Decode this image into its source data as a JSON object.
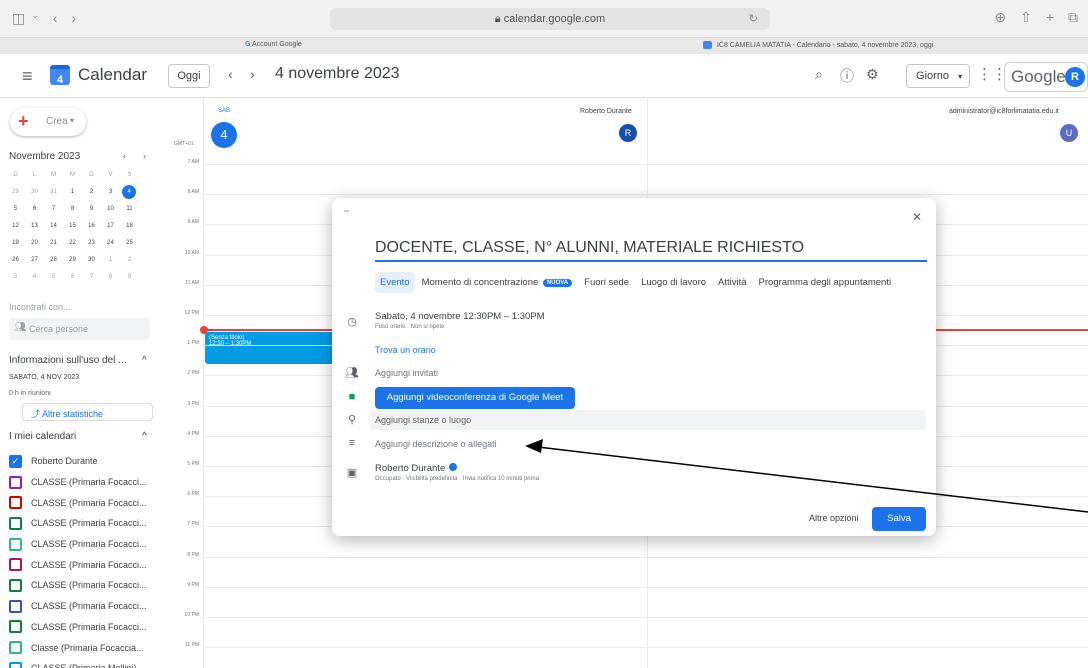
{
  "browser": {
    "url": "calendar.google.com",
    "tabs": [
      "Account Google",
      "IC8 CAMELIA MATATIA - Calendario - sabato, 4 novembre 2023, oggi"
    ]
  },
  "header": {
    "app_name": "Calendar",
    "today_label": "Oggi",
    "date_title": "4 novembre 2023",
    "view_label": "Giorno",
    "google_word": "Google",
    "avatar_letter": "R"
  },
  "sidebar": {
    "create_label": "Crea",
    "mini_calendar": {
      "title": "Novembre 2023",
      "weekdays": [
        "D",
        "L",
        "M",
        "M",
        "G",
        "V",
        "S"
      ],
      "days": [
        {
          "d": "29",
          "muted": true
        },
        {
          "d": "30",
          "muted": true
        },
        {
          "d": "31",
          "muted": true
        },
        {
          "d": "1"
        },
        {
          "d": "2"
        },
        {
          "d": "3"
        },
        {
          "d": "4",
          "selected": true
        },
        {
          "d": "5"
        },
        {
          "d": "6"
        },
        {
          "d": "7"
        },
        {
          "d": "8"
        },
        {
          "d": "9"
        },
        {
          "d": "10"
        },
        {
          "d": "11"
        },
        {
          "d": "12"
        },
        {
          "d": "13"
        },
        {
          "d": "14"
        },
        {
          "d": "15"
        },
        {
          "d": "16"
        },
        {
          "d": "17"
        },
        {
          "d": "18"
        },
        {
          "d": "19"
        },
        {
          "d": "20"
        },
        {
          "d": "21"
        },
        {
          "d": "22"
        },
        {
          "d": "23"
        },
        {
          "d": "24"
        },
        {
          "d": "25"
        },
        {
          "d": "26"
        },
        {
          "d": "27"
        },
        {
          "d": "28"
        },
        {
          "d": "29"
        },
        {
          "d": "30"
        },
        {
          "d": "1",
          "muted": true
        },
        {
          "d": "2",
          "muted": true
        },
        {
          "d": "3",
          "muted": true
        },
        {
          "d": "4",
          "muted": true
        },
        {
          "d": "5",
          "muted": true
        },
        {
          "d": "6",
          "muted": true
        },
        {
          "d": "7",
          "muted": true
        },
        {
          "d": "8",
          "muted": true
        },
        {
          "d": "9",
          "muted": true
        }
      ]
    },
    "meet_title": "Incontrati con...",
    "people_placeholder": "Cerca persone",
    "info_title": "Informazioni sull'uso del ...",
    "info_date": "SABATO, 4 NOV 2023",
    "info_meetings": "0 h in riunioni",
    "stats_label": "Altre statistiche",
    "my_calendars_title": "I miei calendari",
    "calendars": [
      {
        "name": "Roberto Durante",
        "color": "#1a73e8",
        "checked": true
      },
      {
        "name": "CLASSE (Primaria Focacci...",
        "color": "#8e24aa",
        "checked": false
      },
      {
        "name": "CLASSE (Primaria Focacci...",
        "color": "#d50000",
        "checked": false
      },
      {
        "name": "CLASSE (Primaria Focacci...",
        "color": "#0b8043",
        "checked": false
      },
      {
        "name": "CLASSE (Primaria Focacci...",
        "color": "#33b679",
        "checked": false
      },
      {
        "name": "CLASSE (Primaria Focacci...",
        "color": "#ad1457",
        "checked": false
      },
      {
        "name": "CLASSE (Primaria Focacci...",
        "color": "#0b8043",
        "checked": false
      },
      {
        "name": "CLASSE (Primaria Focacci...",
        "color": "#3f51b5",
        "checked": false
      },
      {
        "name": "CLASSE (Primaria Focacci...",
        "color": "#0b8043",
        "checked": false
      },
      {
        "name": "Classe (Primaria Focaccia...",
        "color": "#33b679",
        "checked": false
      },
      {
        "name": "CLASSE (Primaria Mellini) ...",
        "color": "#039be5",
        "checked": false
      }
    ]
  },
  "grid": {
    "timezone": "GMT+01",
    "day_abbr": "SAB",
    "day_number": "4",
    "users": [
      {
        "name": "Roberto Durante",
        "letter": "R",
        "color": "#174ea6"
      },
      {
        "name": "administrator@ic8forlimatatia.edu.it",
        "letter": "U",
        "color": "#5c6bc0"
      }
    ],
    "hours": [
      "7 AM",
      "8 AM",
      "9 AM",
      "10 AM",
      "11 AM",
      "12 PM",
      "1 PM",
      "2 PM",
      "3 PM",
      "4 PM",
      "5 PM",
      "6 PM",
      "7 PM",
      "8 PM",
      "9 PM",
      "10 PM",
      "11 PM"
    ],
    "event": {
      "title": "(Senza titolo)",
      "time": "12:30 – 1:30PM"
    }
  },
  "dialog": {
    "title": "DOCENTE, CLASSE, N° ALUNNI, MATERIALE RICHIESTO",
    "tabs": [
      "Evento",
      "Momento di concentrazione",
      "Fuori sede",
      "Luogo di lavoro",
      "Attività",
      "Programma degli appuntamenti"
    ],
    "new_badge": "NUOVA",
    "when": "Sabato, 4 novembre   12:30PM  –  1:30PM",
    "when_sub": "Fuso orario · Non si ripete",
    "find_time": "Trova un orario",
    "add_guests": "Aggiungi invitati",
    "meet_button": "Aggiungi videoconferenza di Google Meet",
    "room_placeholder": "Aggiungi stanze o luogo",
    "description_placeholder": "Aggiungi descrizione o allegati",
    "owner": "Roberto Durante",
    "owner_sub": "Occupato · Visibilità predefinita · Invia notifica 10 minuti prima",
    "more_options": "Altre opzioni",
    "save": "Salva"
  }
}
